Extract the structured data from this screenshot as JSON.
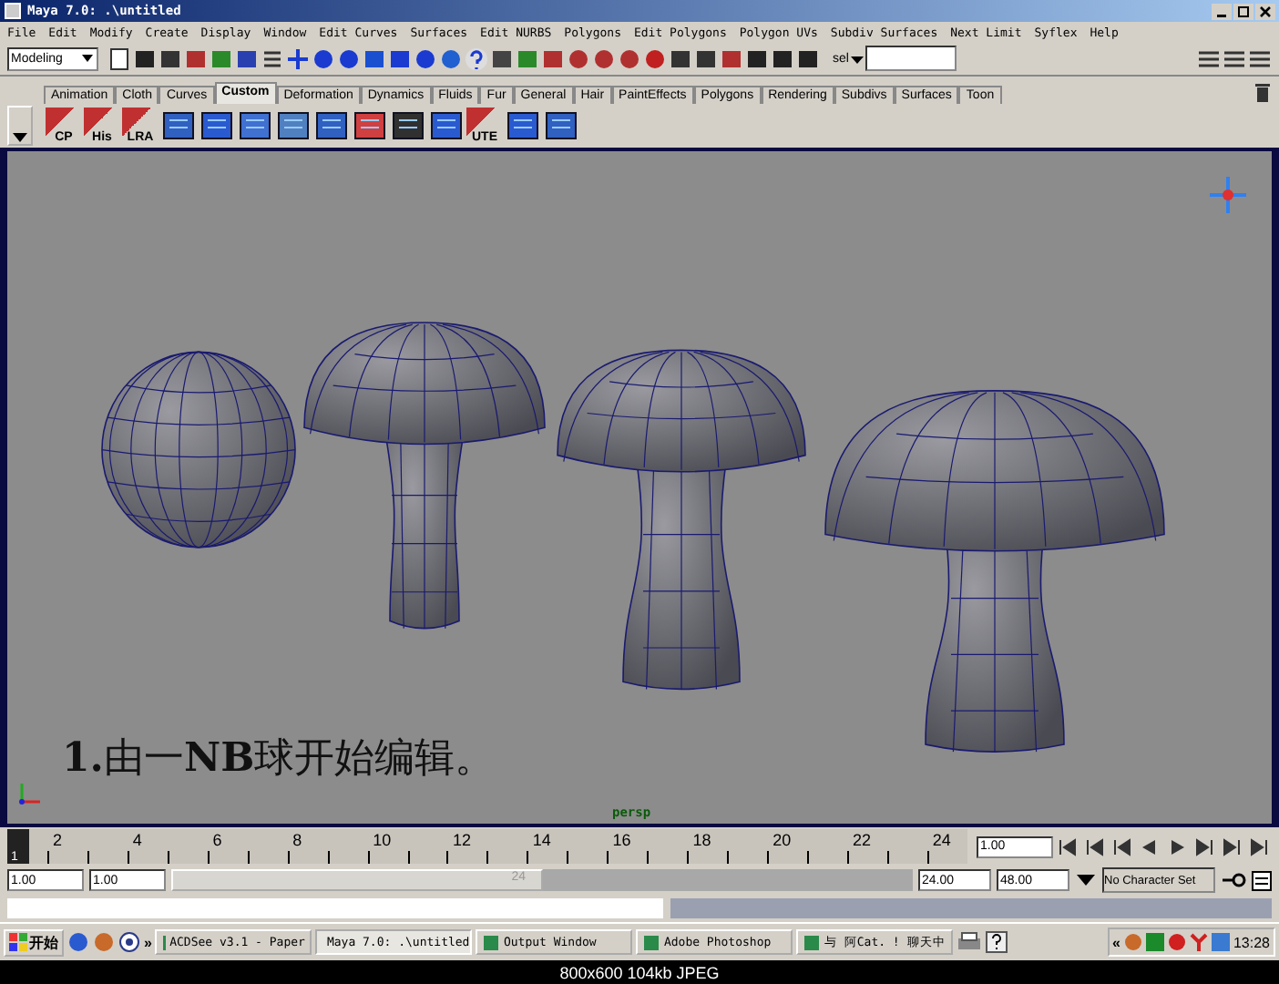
{
  "window": {
    "title": "Maya 7.0: .\\untitled"
  },
  "menu": [
    "File",
    "Edit",
    "Modify",
    "Create",
    "Display",
    "Window",
    "Edit Curves",
    "Surfaces",
    "Edit NURBS",
    "Polygons",
    "Edit Polygons",
    "Polygon UVs",
    "Subdiv Surfaces",
    "Next Limit",
    "Syflex",
    "Help"
  ],
  "status_line": {
    "mode": "Modeling",
    "selection_label": "sel"
  },
  "shelf_tabs": [
    {
      "label": "Animation",
      "selected": false
    },
    {
      "label": "Cloth",
      "selected": false
    },
    {
      "label": "Curves",
      "selected": false
    },
    {
      "label": "Custom",
      "selected": true
    },
    {
      "label": "Deformation",
      "selected": false
    },
    {
      "label": "Dynamics",
      "selected": false
    },
    {
      "label": "Fluids",
      "selected": false
    },
    {
      "label": "Fur",
      "selected": false
    },
    {
      "label": "General",
      "selected": false
    },
    {
      "label": "Hair",
      "selected": false
    },
    {
      "label": "PaintEffects",
      "selected": false
    },
    {
      "label": "Polygons",
      "selected": false
    },
    {
      "label": "Rendering",
      "selected": false
    },
    {
      "label": "Subdivs",
      "selected": false
    },
    {
      "label": "Surfaces",
      "selected": false
    },
    {
      "label": "Toon",
      "selected": false
    }
  ],
  "shelf_buttons": [
    {
      "kind": "text",
      "label": "CP"
    },
    {
      "kind": "text",
      "label": "His"
    },
    {
      "kind": "text",
      "label": "LRA"
    },
    {
      "kind": "icon"
    },
    {
      "kind": "icon"
    },
    {
      "kind": "icon"
    },
    {
      "kind": "icon"
    },
    {
      "kind": "icon"
    },
    {
      "kind": "icon"
    },
    {
      "kind": "icon"
    },
    {
      "kind": "icon"
    },
    {
      "kind": "text",
      "label": "UTE"
    },
    {
      "kind": "icon"
    },
    {
      "kind": "icon"
    }
  ],
  "viewport": {
    "caption": "**1.**由一**NB**球开始编辑。",
    "camera": "persp"
  },
  "timeline": {
    "level": 0,
    "current_frame": "1",
    "tick_labels": [
      "2",
      "4",
      "6",
      "8",
      "10",
      "12",
      "14",
      "16",
      "18",
      "20",
      "22"
    ],
    "end_label": "24",
    "current_time": "1.00"
  },
  "range": {
    "level": 0.5,
    "start": "1.00",
    "playback_start": "1.00",
    "slider_label": "24",
    "playback_end": "24.00",
    "end": "48.00",
    "character_set": "No Character Set"
  },
  "taskbar": {
    "start": "开始",
    "more_left": "»",
    "tasks": [
      {
        "label": "ACDSee v3.1 - Paper",
        "selected": false
      },
      {
        "label": "Maya 7.0: .\\untitled",
        "selected": true
      },
      {
        "label": "Output Window",
        "selected": false
      },
      {
        "label": "Adobe Photoshop",
        "selected": false
      },
      {
        "label": "与 阿Cat. ! 聊天中",
        "selected": false
      }
    ],
    "more_right": "«",
    "clock": "13:28"
  },
  "image_info": "800x600 104kb JPEG"
}
